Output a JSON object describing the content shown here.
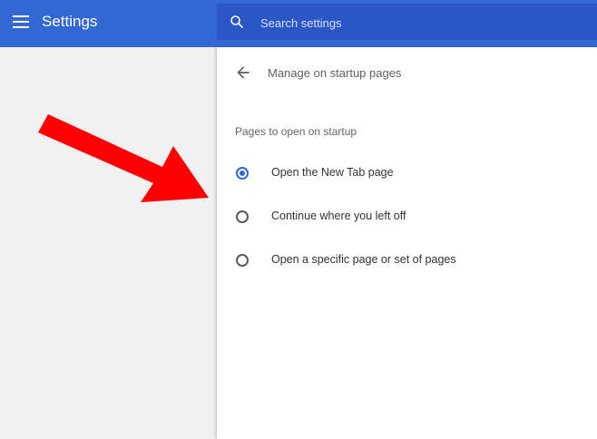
{
  "toolbar": {
    "title": "Settings",
    "search_placeholder": "Search settings"
  },
  "subpage": {
    "title": "Manage on startup pages",
    "section_label": "Pages to open on startup",
    "options": [
      {
        "label": "Open the New Tab page",
        "checked": true
      },
      {
        "label": "Continue where you left off",
        "checked": false
      },
      {
        "label": "Open a specific page or set of pages",
        "checked": false
      }
    ]
  },
  "colors": {
    "toolbar": "#3367d6",
    "search": "#2a56c6",
    "accent": "#3367d6",
    "annotation_arrow": "#ff0000"
  },
  "icons": {
    "menu": "hamburger-menu-icon",
    "search": "search-icon",
    "back": "arrow-back-icon"
  }
}
